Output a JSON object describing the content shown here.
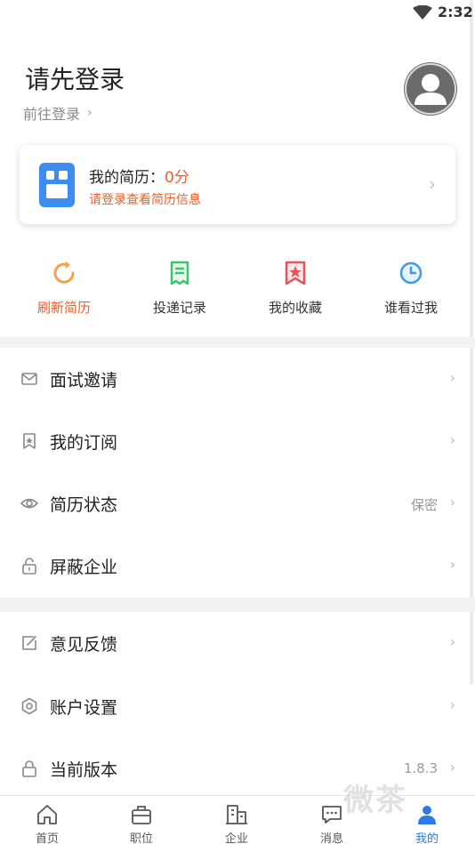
{
  "status_bar": {
    "time": "2:32",
    "wifi_icon": "wifi-icon"
  },
  "header": {
    "title": "请先登录",
    "login_link": "前往登录",
    "login_chevron": "›",
    "avatar_icon": "avatar-icon"
  },
  "resume_card": {
    "label": "我的简历：",
    "score": "0分",
    "hint": "请登录查看简历信息",
    "chevron": "›",
    "icon": "resume-doc-icon"
  },
  "quick_actions": [
    {
      "label": "刷新简历",
      "icon": "refresh-icon",
      "color": "#f5a04a",
      "active": true
    },
    {
      "label": "投递记录",
      "icon": "document-list-icon",
      "color": "#3cc46e",
      "active": false
    },
    {
      "label": "我的收藏",
      "icon": "bookmark-star-icon",
      "color": "#e8545a",
      "active": false
    },
    {
      "label": "谁看过我",
      "icon": "clock-icon",
      "color": "#3b9be8",
      "active": false
    }
  ],
  "menu_group1": [
    {
      "label": "面试邀请",
      "icon": "mail-icon",
      "value": "",
      "chevron": "›"
    },
    {
      "label": "我的订阅",
      "icon": "bookmark-icon",
      "value": "",
      "chevron": "›"
    },
    {
      "label": "简历状态",
      "icon": "eye-icon",
      "value": "保密",
      "chevron": "›"
    },
    {
      "label": "屏蔽企业",
      "icon": "unlock-icon",
      "value": "",
      "chevron": "›"
    }
  ],
  "menu_group2": [
    {
      "label": "意见反馈",
      "icon": "edit-icon",
      "value": "",
      "chevron": "›"
    },
    {
      "label": "账户设置",
      "icon": "settings-gear-icon",
      "value": "",
      "chevron": "›"
    },
    {
      "label": "当前版本",
      "icon": "lock-icon",
      "value": "1.8.3",
      "chevron": "›"
    }
  ],
  "tab_bar": [
    {
      "label": "首页",
      "icon": "home-icon",
      "active": false
    },
    {
      "label": "职位",
      "icon": "briefcase-icon",
      "active": false
    },
    {
      "label": "企业",
      "icon": "building-icon",
      "active": false
    },
    {
      "label": "消息",
      "icon": "message-icon",
      "active": false
    },
    {
      "label": "我的",
      "icon": "profile-icon",
      "active": true
    }
  ],
  "colors": {
    "accent": "#f25c1e",
    "tab_active": "#2a7be8",
    "divider": "#f2f2f2"
  },
  "watermark": "微茶"
}
